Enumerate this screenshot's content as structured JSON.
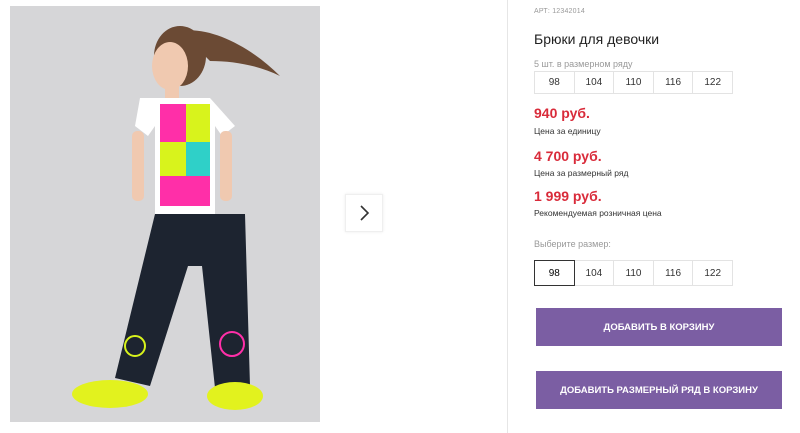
{
  "product": {
    "article": "АРТ: 12342014",
    "title": "Брюки для девочки",
    "set_label": "5 шт. в размерном ряду",
    "set_sizes": [
      "98",
      "104",
      "110",
      "116",
      "122"
    ],
    "price_unit": "940 руб.",
    "price_unit_note": "Цена за единицу",
    "price_set": "4 700 руб.",
    "price_set_note": "Цена за размерный ряд",
    "price_retail": "1 999 руб.",
    "price_retail_note": "Рекомендуемая розничная цена",
    "choose_size_label": "Выберите размер:",
    "sizes": [
      "98",
      "104",
      "110",
      "116",
      "122"
    ],
    "selected_size": "98"
  },
  "actions": {
    "add_to_cart": "Добавить в корзину",
    "add_set_to_cart": "Добавить размерный ряд в корзину"
  },
  "colors": {
    "accent": "#7b5ea3",
    "price": "#d92b3a",
    "neon": "#d8f31c",
    "pink": "#ff2fa8"
  },
  "icons": {
    "next": "chevron-right-icon"
  }
}
